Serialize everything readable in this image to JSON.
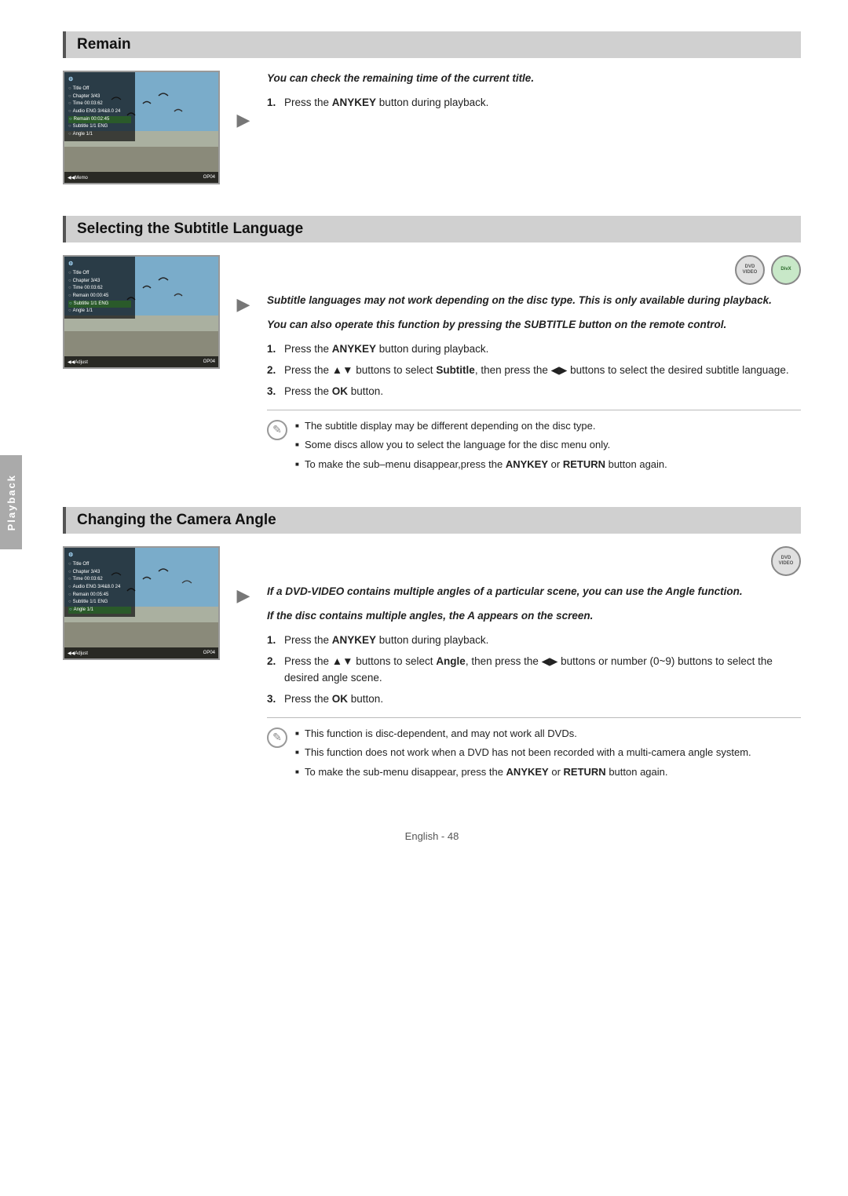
{
  "page": {
    "footer": "English - 48",
    "side_tab": "Playback"
  },
  "sections": {
    "remain": {
      "title": "Remain",
      "intro": "You can check the remaining time of the current title.",
      "steps": [
        {
          "num": "1.",
          "text": "Press the ",
          "bold": "ANYKEY",
          "rest": " button during playback."
        }
      ],
      "screen": {
        "osd_rows": [
          "Title  Off",
          "Chapter  3/43",
          "Time  00:03:62",
          "Audio  ENG 3/48.0 24 1/1",
          "Remain  00:02:45",
          "Subtitle  1/1 ENG",
          "Angle  1/1"
        ],
        "bottom_left": "◀◀Memo",
        "bottom_right": "OP04"
      }
    },
    "subtitle": {
      "title": "Selecting the Subtitle Language",
      "badges": [
        "DVD-VIDEO",
        "DIVX"
      ],
      "intro1": "Subtitle languages may not work depending on the disc type. This is only available during playback.",
      "intro2": "You can also operate this function by pressing the SUBTITLE button on the remote control.",
      "steps": [
        {
          "num": "1.",
          "text": "Press the ",
          "bold": "ANYKEY",
          "rest": " button during playback."
        },
        {
          "num": "2.",
          "text": "Press the ▲▼ buttons to select ",
          "bold": "Subtitle",
          "rest": ", then press the ◀▶ buttons to select the desired subtitle language."
        },
        {
          "num": "3.",
          "text": "Press the ",
          "bold": "OK",
          "rest": " button."
        }
      ],
      "notes": [
        "The subtitle display may be different depending on the disc type.",
        "Some discs allow you to select the language for the disc menu only.",
        "To make the sub–menu disappear,press the ANYKEY or RETURN button again."
      ],
      "notes_bold_parts": [
        "ANYKEY",
        "RETURN"
      ],
      "screen": {
        "osd_rows": [
          "Title  Off",
          "Chapter  3/43",
          "Time  00:03:62",
          "Remain  00:00:45",
          "Subtitle  1/ ENG",
          "Angle  1/1"
        ],
        "highlight_row": "Subtitle  1/ ENG",
        "bottom_left": "◀◀Adjust",
        "bottom_right": "OP04"
      }
    },
    "camera": {
      "title": "Changing the Camera Angle",
      "badges": [
        "DVD-VIDEO"
      ],
      "intro1": "If a DVD-VIDEO contains multiple angles of a particular scene, you can use the Angle function.",
      "intro2": "If the disc contains multiple angles, the A appears on the screen.",
      "steps": [
        {
          "num": "1.",
          "text": "Press the ",
          "bold": "ANYKEY",
          "rest": " button during playback."
        },
        {
          "num": "2.",
          "text": "Press the ▲▼ buttons to select ",
          "bold": "Angle",
          "rest": ", then press the ◀▶ buttons or number (0~9) buttons to select the desired angle scene."
        },
        {
          "num": "3.",
          "text": "Press the ",
          "bold": "OK",
          "rest": " button."
        }
      ],
      "notes": [
        "This function is disc-dependent, and may not work all DVDs.",
        "This function does not work when a DVD has not been recorded with a multi-camera angle system.",
        "To make the sub-menu disappear, press the ANYKEY or RETURN button again."
      ],
      "screen": {
        "osd_rows": [
          "Title  Off",
          "Chapter  3/43",
          "Time  00:03:62",
          "Audio  ENG 3/48.0 24 1/1",
          "Remain  00:05:45",
          "Subtitle  1/1 ENG",
          "Angle  1/1"
        ],
        "highlight_row": "Angle  1/1",
        "bottom_left": "◀◀Adjust",
        "bottom_right": "OP04"
      }
    }
  }
}
